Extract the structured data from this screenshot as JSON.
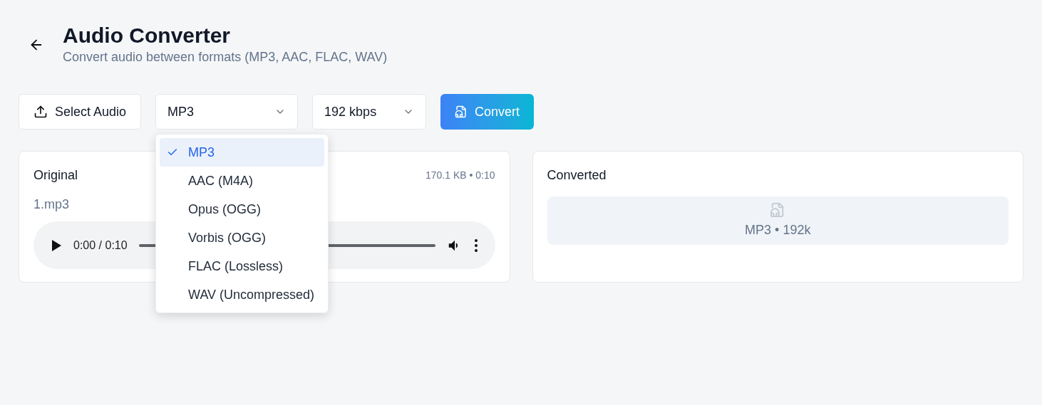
{
  "header": {
    "title": "Audio Converter",
    "subtitle": "Convert audio between formats (MP3, AAC, FLAC, WAV)"
  },
  "toolbar": {
    "select_button": "Select Audio",
    "format_select": {
      "value": "MP3"
    },
    "bitrate_select": {
      "value": "192 kbps"
    },
    "convert_button": "Convert"
  },
  "format_menu": [
    {
      "label": "MP3",
      "selected": true
    },
    {
      "label": "AAC (M4A)",
      "selected": false
    },
    {
      "label": "Opus (OGG)",
      "selected": false
    },
    {
      "label": "Vorbis (OGG)",
      "selected": false
    },
    {
      "label": "FLAC (Lossless)",
      "selected": false
    },
    {
      "label": "WAV (Uncompressed)",
      "selected": false
    }
  ],
  "original": {
    "title": "Original",
    "meta": "170.1 KB • 0:10",
    "filename": "1.mp3",
    "player": {
      "time": "0:00 / 0:10"
    }
  },
  "converted": {
    "title": "Converted",
    "placeholder": "MP3 • 192k"
  }
}
